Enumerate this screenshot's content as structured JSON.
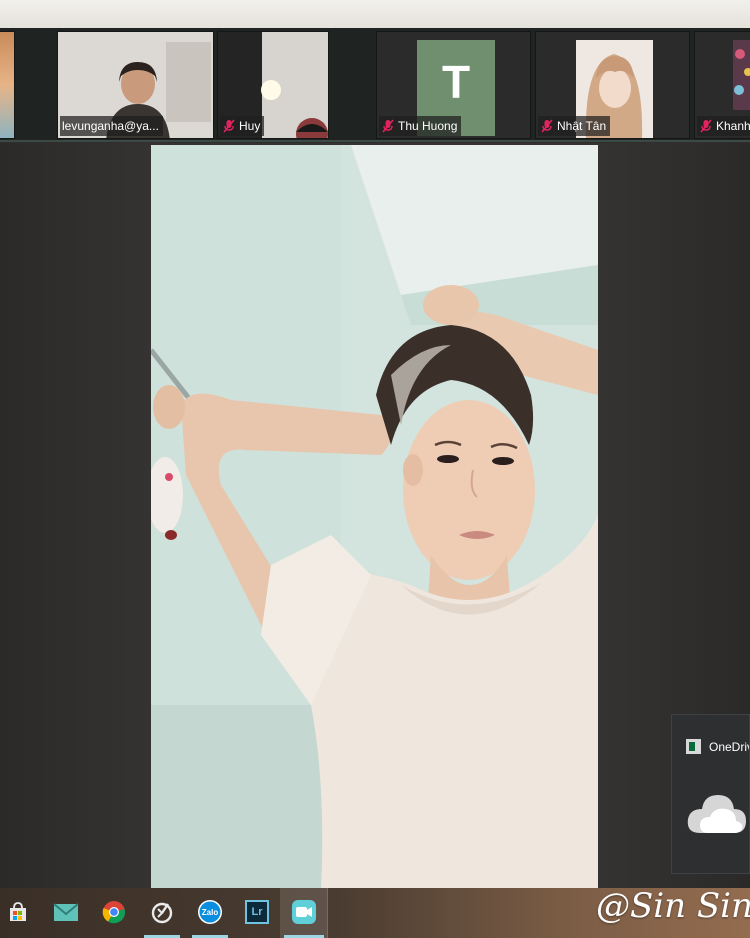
{
  "participants": [
    {
      "name": ""
    },
    {
      "name": "levunganha@ya..."
    },
    {
      "name": "Huy"
    },
    {
      "name": "Thu Huong",
      "avatar_letter": "T"
    },
    {
      "name": "Nhật Tân"
    },
    {
      "name": "Khanh"
    }
  ],
  "notification": {
    "app_name": "OneDrive",
    "icon": "onedrive-cloud-icon"
  },
  "taskbar": {
    "items": [
      "store-icon",
      "mail-icon",
      "chrome-icon",
      "photos-icon",
      "zalo-icon",
      "lightroom-icon",
      "zoom-icon"
    ],
    "zalo_label": "Zalo",
    "lightroom_label": "Lr"
  },
  "watermark": "@Sin Sin",
  "colors": {
    "avatar_bg": "#6f8f6f",
    "mic_muted": "#e0245e",
    "active_taskbar": "#9fd6e6"
  }
}
